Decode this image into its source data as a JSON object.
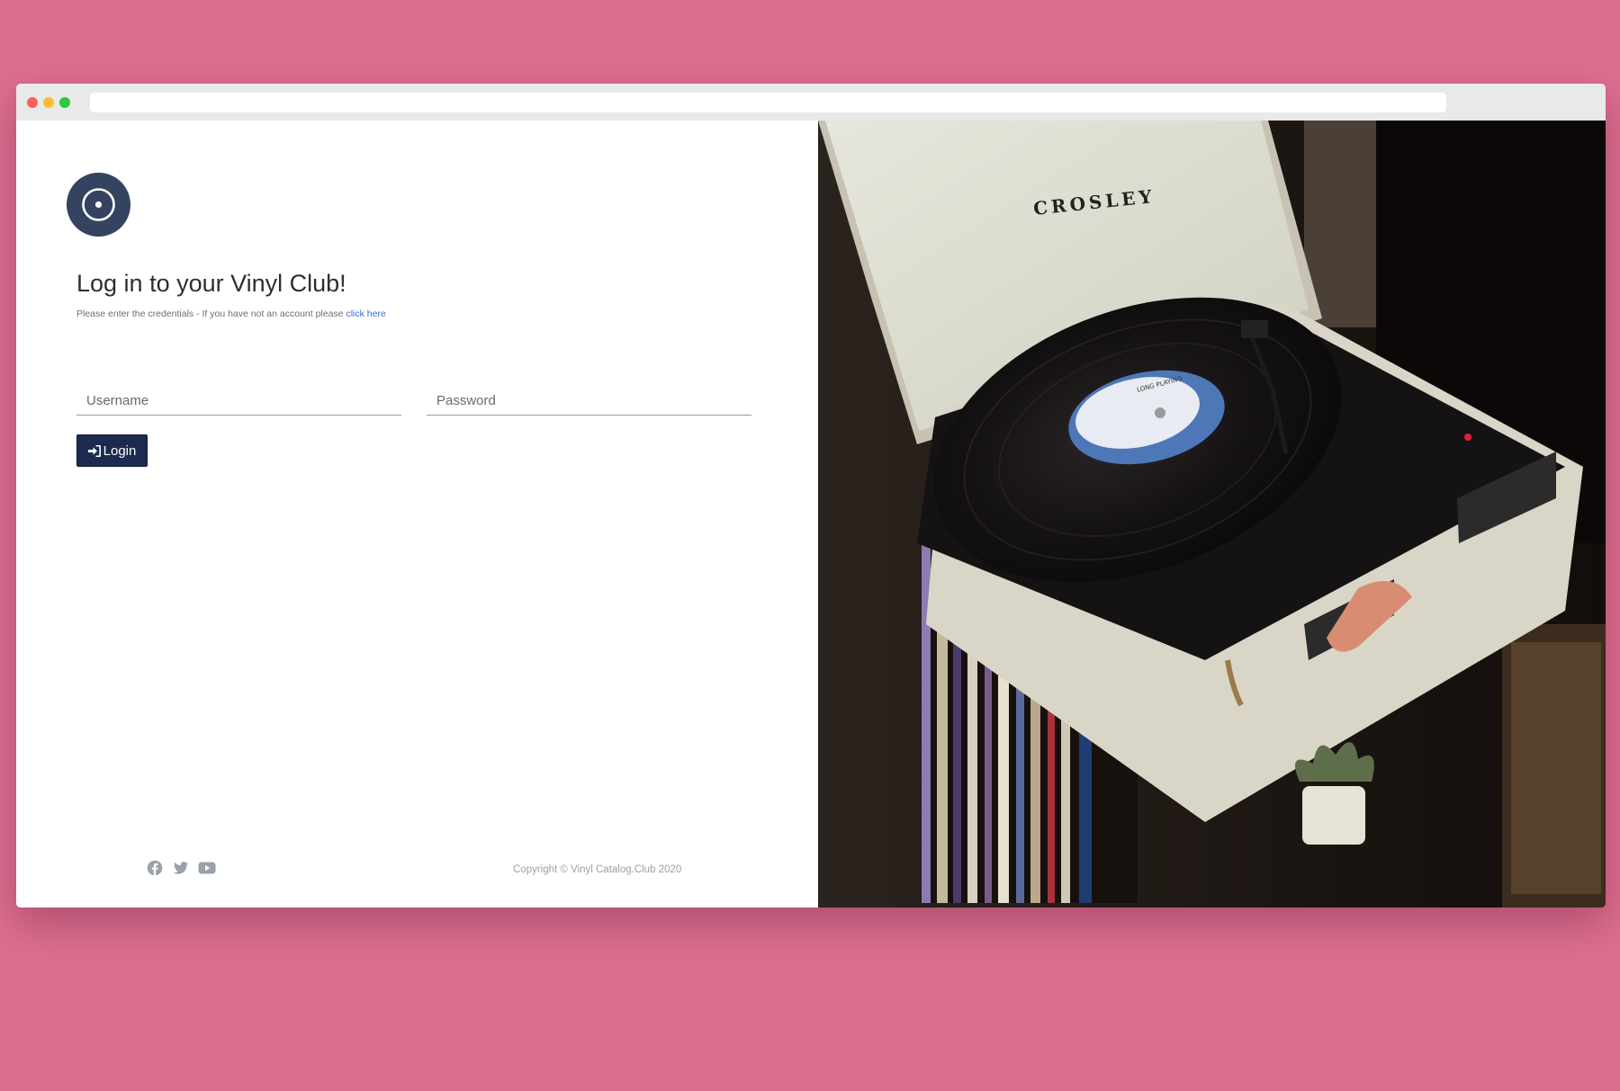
{
  "browser": {
    "address": "",
    "traffic_lights": {
      "close": "#ff5f57",
      "minimize": "#febc2e",
      "maximize": "#28c840"
    }
  },
  "login": {
    "logo_icon": "vinyl-record-icon",
    "title": "Log in to your Vinyl Club!",
    "subtitle": "Please enter the credentials - If you have not an account please",
    "signup_link": "click here",
    "username_placeholder": "Username",
    "username_value": "",
    "password_placeholder": "Password",
    "password_value": "",
    "login_button_label": "Login",
    "login_button_icon": "sign-in-icon"
  },
  "footer": {
    "social": [
      "facebook-icon",
      "twitter-icon",
      "youtube-icon"
    ],
    "copyright": "Copyright © Vinyl Catalog.Club 2020"
  },
  "photo": {
    "lid_brand": "CROSLEY",
    "record_label": "LONG PLAYING"
  },
  "colors": {
    "page_background": "#dd6e90",
    "logo_background": "#34435f",
    "button_background": "#1b2a4e",
    "link": "#3c6fd8"
  }
}
